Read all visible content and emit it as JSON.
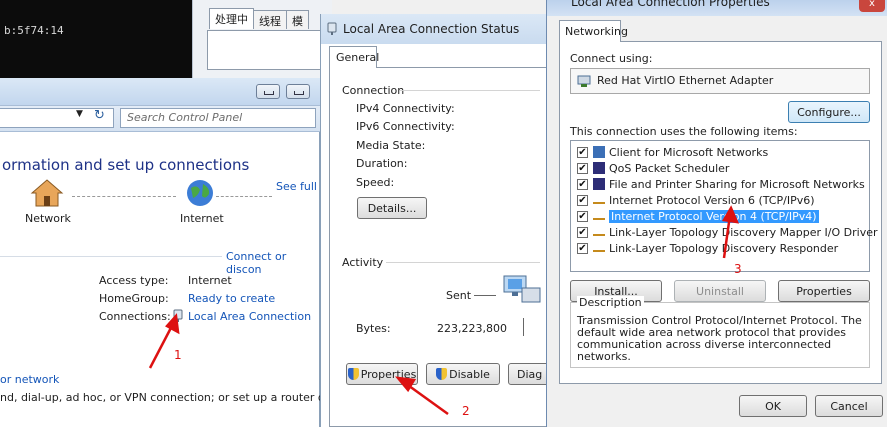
{
  "terminal": {
    "text": "b:5f74:14"
  },
  "task_manager": {
    "tabs": [
      "处理中",
      "线程",
      "模"
    ]
  },
  "control_panel": {
    "search_placeholder": "Search Control Panel",
    "heading": "ormation and set up connections",
    "see_full": "See full",
    "network_label": "Network",
    "internet_label": "Internet",
    "connect_link": "Connect or discon",
    "access_type_label": "Access type:",
    "access_type_value": "Internet",
    "homegroup_label": "HomeGroup:",
    "homegroup_value": "Ready to create",
    "connections_label": "Connections:",
    "connections_value": "Local Area Connection",
    "new_network_link": "or network",
    "dialup_text": "nd, dial-up, ad hoc, or VPN connection; or set up a router or acc"
  },
  "status_window": {
    "title": "Local Area Connection Status",
    "tab": "General",
    "connection_group": "Connection",
    "fields": [
      "IPv4 Connectivity:",
      "IPv6 Connectivity:",
      "Media State:",
      "Duration:",
      "Speed:"
    ],
    "details_button": "Details...",
    "activity_group": "Activity",
    "sent_label": "Sent",
    "bytes_label": "Bytes:",
    "bytes_value": "223,223,800",
    "properties_button": "Properties",
    "disable_button": "Disable",
    "diagnose_button": "Diag"
  },
  "properties_window": {
    "title": "Local Area Connection Properties",
    "close": "x",
    "tab": "Networking",
    "connect_using_label": "Connect using:",
    "adapter": "Red Hat VirtIO Ethernet Adapter",
    "configure_button": "Configure...",
    "items_label": "This connection uses the following items:",
    "items": [
      {
        "label": "Client for Microsoft Networks",
        "checked": true,
        "icon": "network-client-icon"
      },
      {
        "label": "QoS Packet Scheduler",
        "checked": true,
        "icon": "network-service-icon"
      },
      {
        "label": "File and Printer Sharing for Microsoft Networks",
        "checked": true,
        "icon": "network-service-icon"
      },
      {
        "label": "Internet Protocol Version 6 (TCP/IPv6)",
        "checked": true,
        "icon": "protocol-icon"
      },
      {
        "label": "Internet Protocol Version 4 (TCP/IPv4)",
        "checked": true,
        "icon": "protocol-icon",
        "selected": true
      },
      {
        "label": "Link-Layer Topology Discovery Mapper I/O Driver",
        "checked": true,
        "icon": "protocol-icon"
      },
      {
        "label": "Link-Layer Topology Discovery Responder",
        "checked": true,
        "icon": "protocol-icon"
      }
    ],
    "check_mark": "✔",
    "install_button": "Install...",
    "uninstall_button": "Uninstall",
    "properties_button": "Properties",
    "description_legend": "Description",
    "description_text": "Transmission Control Protocol/Internet Protocol. The default wide area network protocol that provides communication across diverse interconnected networks.",
    "ok_button": "OK",
    "cancel_button": "Cancel"
  },
  "annotations": {
    "step1": "1",
    "step2": "2",
    "step3": "3",
    "color": "#dd1111"
  }
}
